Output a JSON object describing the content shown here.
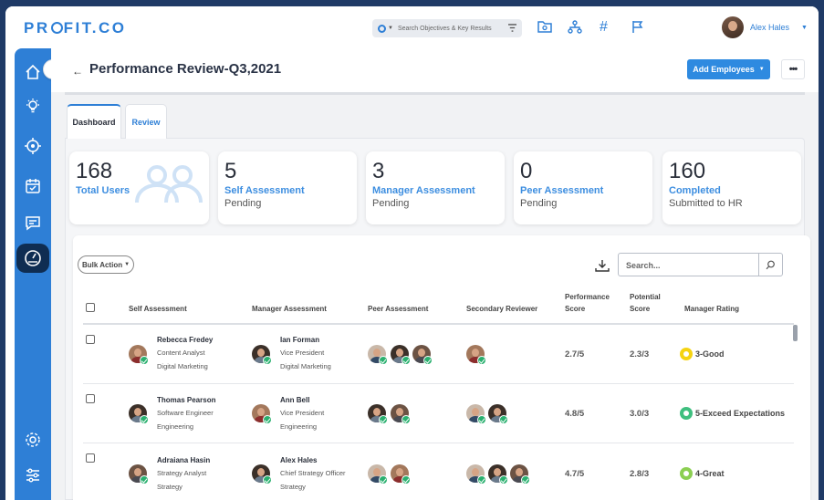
{
  "app": {
    "logo": "PR FIT.CO",
    "logo_left": "PR",
    "logo_right": "FIT.CO"
  },
  "topbar": {
    "search_placeholder": "Search Objectives & Key Results",
    "user_name": "Alex Hales",
    "icons": [
      "folder-search-icon",
      "hierarchy-icon",
      "hash-icon",
      "flag-icon"
    ]
  },
  "sidebar": {
    "icons": [
      "home-icon",
      "lightbulb-icon",
      "target-icon",
      "calendar-check-icon",
      "chat-icon",
      "dashboard-gauge-icon",
      "settings-icon",
      "sliders-icon"
    ]
  },
  "page": {
    "title": "Performance Review-Q3,2021",
    "add_button": "Add Employees",
    "more_button": "•••"
  },
  "tabs": [
    {
      "label": "Dashboard",
      "active": true
    },
    {
      "label": "Review",
      "active": false
    }
  ],
  "cards": [
    {
      "num": "168",
      "line1": "Total Users",
      "line2": ""
    },
    {
      "num": "5",
      "line1": "Self Assessment",
      "line2": "Pending"
    },
    {
      "num": "3",
      "line1": "Manager Assessment",
      "line2": "Pending"
    },
    {
      "num": "0",
      "line1": "Peer Assessment",
      "line2": "Pending"
    },
    {
      "num": "160",
      "line1": "Completed",
      "line2": "Submitted to HR"
    }
  ],
  "table": {
    "bulk_action": "Bulk Action",
    "search_placeholder": "Search...",
    "headers": {
      "self": "Self Assessment",
      "manager": "Manager Assessment",
      "peer": "Peer Assessment",
      "secondary": "Secondary Reviewer",
      "perf_line1": "Performance",
      "perf_line2": "Score",
      "pot_line1": "Potential",
      "pot_line2": "Score",
      "rating": "Manager Rating"
    },
    "rows": [
      {
        "self": {
          "name": "Rebecca Fredey",
          "title": "Content Analyst",
          "dept": "Digital Marketing"
        },
        "manager": {
          "name": "Ian Forman",
          "title": "Vice President",
          "dept": "Digital Marketing"
        },
        "peer_count": 3,
        "secondary_count": 1,
        "perf": "2.7/5",
        "potential": "2.3/3",
        "rating": "3-Good",
        "rating_color": "#f5d311"
      },
      {
        "self": {
          "name": "Thomas Pearson",
          "title": "Software Engineer",
          "dept": "Engineering"
        },
        "manager": {
          "name": "Ann Bell",
          "title": "Vice President",
          "dept": "Engineering"
        },
        "peer_count": 2,
        "secondary_count": 2,
        "perf": "4.8/5",
        "potential": "3.0/3",
        "rating": "5-Exceed Expectations",
        "rating_color": "#3fbf7f"
      },
      {
        "self": {
          "name": "Adraiana Hasin",
          "title": "Strategy Analyst",
          "dept": "Strategy"
        },
        "manager": {
          "name": "Alex Hales",
          "title": "Chief Strategy Officer",
          "dept": "Strategy"
        },
        "peer_count": 2,
        "secondary_count": 3,
        "perf": "4.7/5",
        "potential": "2.8/3",
        "rating": "4-Great",
        "rating_color": "#8ccf52"
      }
    ]
  }
}
